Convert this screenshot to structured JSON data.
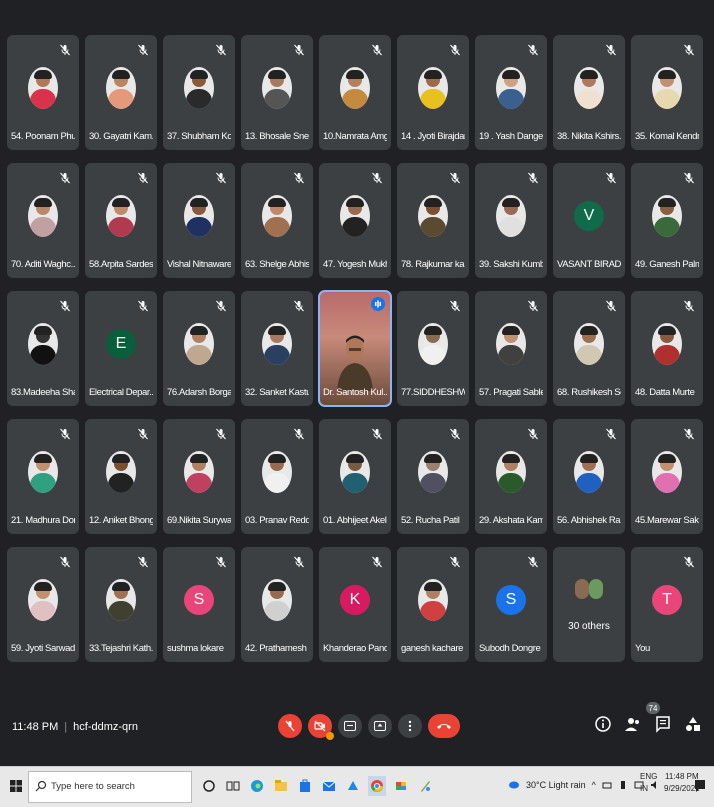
{
  "participants": [
    {
      "name": "54. Poonam Phul...",
      "kind": "photo",
      "shirt": "#d9324a",
      "skin": "#b07a5a"
    },
    {
      "name": "30. Gayatri Kam...",
      "kind": "photo",
      "shirt": "#e49a7a",
      "skin": "#b98560"
    },
    {
      "name": "37. Shubham Kot...",
      "kind": "photo",
      "shirt": "#2a2a2a",
      "skin": "#8a5a3a"
    },
    {
      "name": "13. Bhosale Snehal",
      "kind": "photo",
      "shirt": "#555",
      "skin": "#a87860"
    },
    {
      "name": "10.Namrata Amge",
      "kind": "photo",
      "shirt": "#c48a40",
      "skin": "#b08060"
    },
    {
      "name": "14 . Jyoti Birajdar",
      "kind": "photo",
      "shirt": "#e8c020",
      "skin": "#a06a4a"
    },
    {
      "name": "19 . Yash Dange",
      "kind": "photo",
      "shirt": "#3a6090",
      "skin": "#d0a080"
    },
    {
      "name": "38. Nikita Kshirs...",
      "kind": "photo",
      "shirt": "#f0e0d0",
      "skin": "#b07a5a"
    },
    {
      "name": "35. Komal Kendre",
      "kind": "photo",
      "shirt": "#e8d8b0",
      "skin": "#c09070"
    },
    {
      "name": "70. Aditi Waghc...",
      "kind": "photo",
      "shirt": "#c0a0a0",
      "skin": "#b88868"
    },
    {
      "name": "58.Arpita Sardes...",
      "kind": "photo",
      "shirt": "#b03a50",
      "skin": "#c08a6a"
    },
    {
      "name": "Vishal Nitnaware",
      "kind": "photo",
      "shirt": "#203060",
      "skin": "#8a5a40"
    },
    {
      "name": "63. Shelge Abhis...",
      "kind": "photo",
      "shirt": "#a07050",
      "skin": "#c08a6a"
    },
    {
      "name": "47. Yogesh Mukh...",
      "kind": "photo",
      "shirt": "#222",
      "skin": "#9a6a50"
    },
    {
      "name": "78. Rajkumar ka...",
      "kind": "photo",
      "shirt": "#5a4a30",
      "skin": "#7a5030"
    },
    {
      "name": "39. Sakshi Kumb...",
      "kind": "photo",
      "shirt": "#e0e0e0",
      "skin": "#9a6a50"
    },
    {
      "name": "VASANT BIRADAR",
      "kind": "initial",
      "initial": "V",
      "color": "#0f6b4a"
    },
    {
      "name": "49. Ganesh Palm...",
      "kind": "photo",
      "shirt": "#3a6a3a",
      "skin": "#8a6040"
    },
    {
      "name": "83.Madeeha Sha...",
      "kind": "photo",
      "shirt": "#111",
      "skin": "#333"
    },
    {
      "name": "Electrical Depar...",
      "kind": "initial",
      "initial": "E",
      "color": "#0b5e3c"
    },
    {
      "name": "76.Adarsh Borga...",
      "kind": "photo",
      "shirt": "#c0a890",
      "skin": "#b08060"
    },
    {
      "name": "32. Sanket Kastu...",
      "kind": "photo",
      "shirt": "#2a4060",
      "skin": "#a87860"
    },
    {
      "name": "Dr. Santosh Kul...",
      "kind": "video"
    },
    {
      "name": "77.SIDDHESHWA...",
      "kind": "photo",
      "shirt": "#f0f0f0",
      "skin": "#8a6a50"
    },
    {
      "name": "57. Pragati Sable",
      "kind": "photo",
      "shirt": "#404040",
      "skin": "#c09070"
    },
    {
      "name": "68. Rushikesh So...",
      "kind": "photo",
      "shirt": "#d0c8b0",
      "skin": "#9a7050"
    },
    {
      "name": "48. Datta Murte",
      "kind": "photo",
      "shirt": "#b03030",
      "skin": "#8a5a40"
    },
    {
      "name": "21. Madhura Don...",
      "kind": "photo",
      "shirt": "#30a080",
      "skin": "#c09070"
    },
    {
      "name": "12. Aniket Bhong",
      "kind": "photo",
      "shirt": "#222",
      "skin": "#7a5030"
    },
    {
      "name": "69.Nikita Surywa...",
      "kind": "photo",
      "shirt": "#c04060",
      "skin": "#b08060"
    },
    {
      "name": "03. Pranav Reddy",
      "kind": "photo",
      "shirt": "#f0f0f0",
      "skin": "#9a6a50"
    },
    {
      "name": "01. Abhijeet Akele",
      "kind": "photo",
      "shirt": "#206070",
      "skin": "#7a5a40"
    },
    {
      "name": "52. Rucha Patil",
      "kind": "photo",
      "shirt": "#505060",
      "skin": "#9a8070"
    },
    {
      "name": "29. Akshata Kam...",
      "kind": "photo",
      "shirt": "#2a5a2a",
      "skin": "#b08060"
    },
    {
      "name": "56. Abhishek Ra...",
      "kind": "photo",
      "shirt": "#2060c0",
      "skin": "#a07050"
    },
    {
      "name": "45.Marewar Sak...",
      "kind": "photo",
      "shirt": "#e070b0",
      "skin": "#c09070"
    },
    {
      "name": "59. Jyoti Sarwade",
      "kind": "photo",
      "shirt": "#e0c0c0",
      "skin": "#c09070"
    },
    {
      "name": "33.Tejashri Kath...",
      "kind": "photo",
      "shirt": "#404030",
      "skin": "#a07050"
    },
    {
      "name": "sushma lokare",
      "kind": "initial",
      "initial": "S",
      "color": "#e8457a"
    },
    {
      "name": "42. Prathamesh ...",
      "kind": "photo",
      "shirt": "#d0d0d0",
      "skin": "#9a6a50"
    },
    {
      "name": "Khanderao Pand...",
      "kind": "initial",
      "initial": "K",
      "color": "#d81b60"
    },
    {
      "name": "ganesh kachare",
      "kind": "photo",
      "shirt": "#d04040",
      "skin": "#b08060"
    },
    {
      "name": "Subodh Dongre",
      "kind": "initial",
      "initial": "S",
      "color": "#1a73e8"
    },
    {
      "name": "",
      "kind": "others",
      "label": "30 others"
    },
    {
      "name": "You",
      "kind": "initial",
      "initial": "T",
      "color": "#e8457a"
    }
  ],
  "meeting": {
    "time": "11:48 PM",
    "code": "hcf-ddmz-qrn",
    "people_count": "74"
  },
  "controls": [
    {
      "name": "mic-off-button",
      "icon": "mic-off-icon"
    },
    {
      "name": "camera-off-button",
      "icon": "camera-off-icon"
    },
    {
      "name": "captions-button",
      "icon": "cc-icon"
    },
    {
      "name": "present-button",
      "icon": "present-icon"
    },
    {
      "name": "more-options-button",
      "icon": "more-vert-icon"
    },
    {
      "name": "leave-call-button",
      "icon": "phone-hangup-icon"
    }
  ],
  "taskbar": {
    "search_placeholder": "Type here to search",
    "weather": "30°C  Light rain",
    "lang1": "ENG",
    "lang2": "IN",
    "clock_time": "11:48 PM",
    "clock_date": "9/29/2021"
  },
  "colors": {
    "bg": "#202124",
    "tile": "#3c4043",
    "red": "#ea4335",
    "active_outline": "#8ab4f8"
  }
}
